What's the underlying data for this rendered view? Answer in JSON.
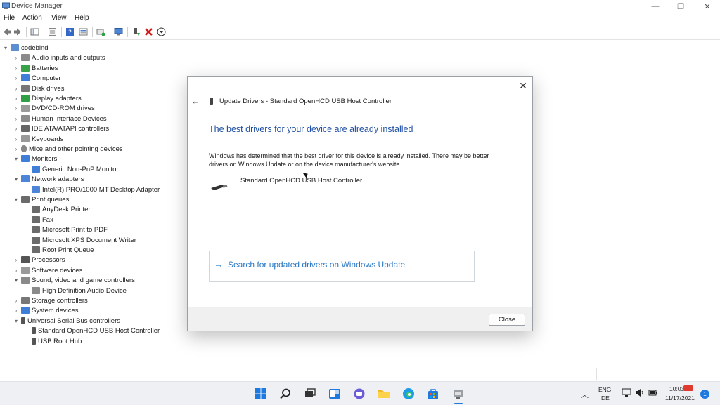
{
  "window": {
    "title": "Device Manager"
  },
  "menu": {
    "file": "File",
    "action": "Action",
    "view": "View",
    "help": "Help"
  },
  "tree": {
    "root": "codebind",
    "items": [
      {
        "label": "Audio inputs and outputs"
      },
      {
        "label": "Batteries"
      },
      {
        "label": "Computer"
      },
      {
        "label": "Disk drives"
      },
      {
        "label": "Display adapters"
      },
      {
        "label": "DVD/CD-ROM drives"
      },
      {
        "label": "Human Interface Devices"
      },
      {
        "label": "IDE ATA/ATAPI controllers"
      },
      {
        "label": "Keyboards"
      },
      {
        "label": "Mice and other pointing devices"
      },
      {
        "label": "Monitors"
      },
      {
        "label": "Generic Non-PnP Monitor"
      },
      {
        "label": "Network adapters"
      },
      {
        "label": "Intel(R) PRO/1000 MT Desktop Adapter"
      },
      {
        "label": "Print queues"
      },
      {
        "label": "AnyDesk Printer"
      },
      {
        "label": "Fax"
      },
      {
        "label": "Microsoft Print to PDF"
      },
      {
        "label": "Microsoft XPS Document Writer"
      },
      {
        "label": "Root Print Queue"
      },
      {
        "label": "Processors"
      },
      {
        "label": "Software devices"
      },
      {
        "label": "Sound, video and game controllers"
      },
      {
        "label": "High Definition Audio Device"
      },
      {
        "label": "Storage controllers"
      },
      {
        "label": "System devices"
      },
      {
        "label": "Universal Serial Bus controllers"
      },
      {
        "label": "Standard OpenHCD USB Host Controller"
      },
      {
        "label": "USB Root Hub"
      }
    ]
  },
  "dialog": {
    "header": "Update Drivers - Standard OpenHCD USB Host Controller",
    "heading": "The best drivers for your device are already installed",
    "description": "Windows has determined that the best driver for this device is already installed. There may be better drivers on Windows Update or on the device manufacturer's website.",
    "device_name": "Standard OpenHCD USB Host Controller",
    "search_label": "Search for updated drivers on Windows Update",
    "close_label": "Close"
  },
  "tray": {
    "lang1": "ENG",
    "lang2": "DE",
    "time": "10:03",
    "date": "11/17/2021",
    "badge": "1"
  },
  "colors": {
    "accent": "#1f4fa3",
    "link": "#2b78c5"
  }
}
